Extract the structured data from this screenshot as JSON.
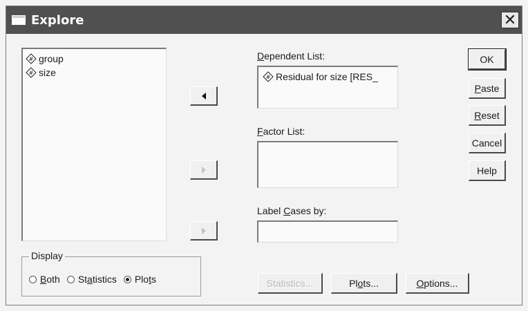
{
  "window": {
    "title": "Explore",
    "close_symbol": "✕"
  },
  "variables": [
    {
      "name": "group",
      "icon": "numeric-variable-icon"
    },
    {
      "name": "size",
      "icon": "numeric-variable-icon"
    }
  ],
  "dependent_list": {
    "label_pre": "",
    "label_accel": "D",
    "label_post": "ependent List:",
    "items": [
      "Residual for size [RES_"
    ]
  },
  "factor_list": {
    "label_pre": "",
    "label_accel": "F",
    "label_post": "actor List:"
  },
  "label_cases": {
    "label_pre": "Label ",
    "label_accel": "C",
    "label_post": "ases by:"
  },
  "buttons": {
    "ok": "OK",
    "paste_accel": "P",
    "paste_rest": "aste",
    "reset_accel": "R",
    "reset_rest": "eset",
    "cancel": "Cancel",
    "help": "Help",
    "statistics": "Statistics...",
    "plots_pre": "Pl",
    "plots_accel": "o",
    "plots_rest": "ts...",
    "options_accel": "O",
    "options_rest": "ptions..."
  },
  "display": {
    "legend": "Display",
    "options": [
      {
        "pre": "",
        "accel": "B",
        "post": "oth",
        "selected": false
      },
      {
        "pre": "St",
        "accel": "a",
        "post": "tistics",
        "selected": false
      },
      {
        "pre": "Plo",
        "accel": "t",
        "post": "s",
        "selected": true
      }
    ]
  }
}
